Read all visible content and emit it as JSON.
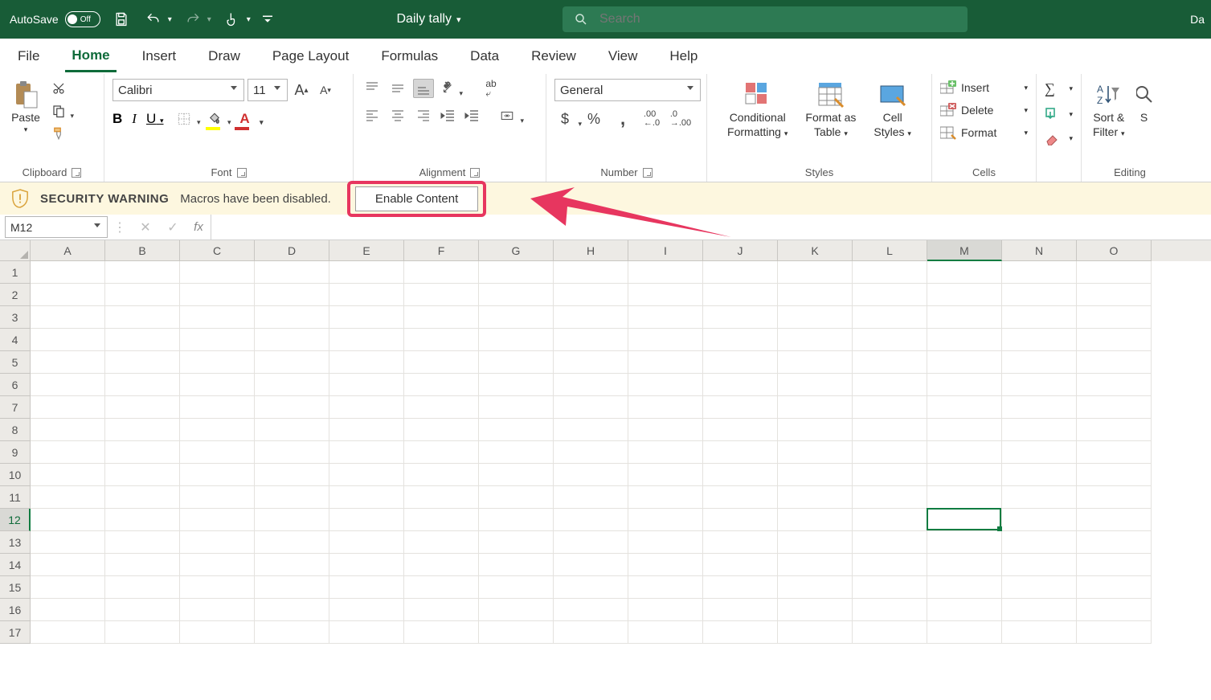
{
  "titlebar": {
    "autosave_label": "AutoSave",
    "autosave_state": "Off",
    "doc_title": "Daily tally",
    "search_placeholder": "Search",
    "right_text_fragment": "Da"
  },
  "tabs": [
    "File",
    "Home",
    "Insert",
    "Draw",
    "Page Layout",
    "Formulas",
    "Data",
    "Review",
    "View",
    "Help"
  ],
  "active_tab": "Home",
  "ribbon": {
    "clipboard": {
      "label": "Clipboard",
      "paste": "Paste"
    },
    "font": {
      "label": "Font",
      "name": "Calibri",
      "size": "11",
      "bold": "B",
      "italic": "I",
      "underline": "U"
    },
    "alignment": {
      "label": "Alignment"
    },
    "number": {
      "label": "Number",
      "format": "General"
    },
    "styles": {
      "label": "Styles",
      "conditional_l1": "Conditional",
      "conditional_l2": "Formatting",
      "format_as_l1": "Format as",
      "format_as_l2": "Table",
      "cell_l1": "Cell",
      "cell_l2": "Styles"
    },
    "cells": {
      "label": "Cells",
      "insert": "Insert",
      "delete": "Delete",
      "format": "Format"
    },
    "editing": {
      "label": "Editing",
      "sort_l1": "Sort &",
      "sort_l2": "Filter",
      "find_frag": "S"
    }
  },
  "security": {
    "title": "SECURITY WARNING",
    "message": "Macros have been disabled.",
    "button": "Enable Content"
  },
  "formula_bar": {
    "name_box": "M12",
    "fx": "fx"
  },
  "sheet": {
    "columns": [
      "A",
      "B",
      "C",
      "D",
      "E",
      "F",
      "G",
      "H",
      "I",
      "J",
      "K",
      "L",
      "M",
      "N",
      "O"
    ],
    "rows": [
      1,
      2,
      3,
      4,
      5,
      6,
      7,
      8,
      9,
      10,
      11,
      12,
      13,
      14,
      15,
      16,
      17
    ],
    "active_col": "M",
    "active_row": 12
  }
}
